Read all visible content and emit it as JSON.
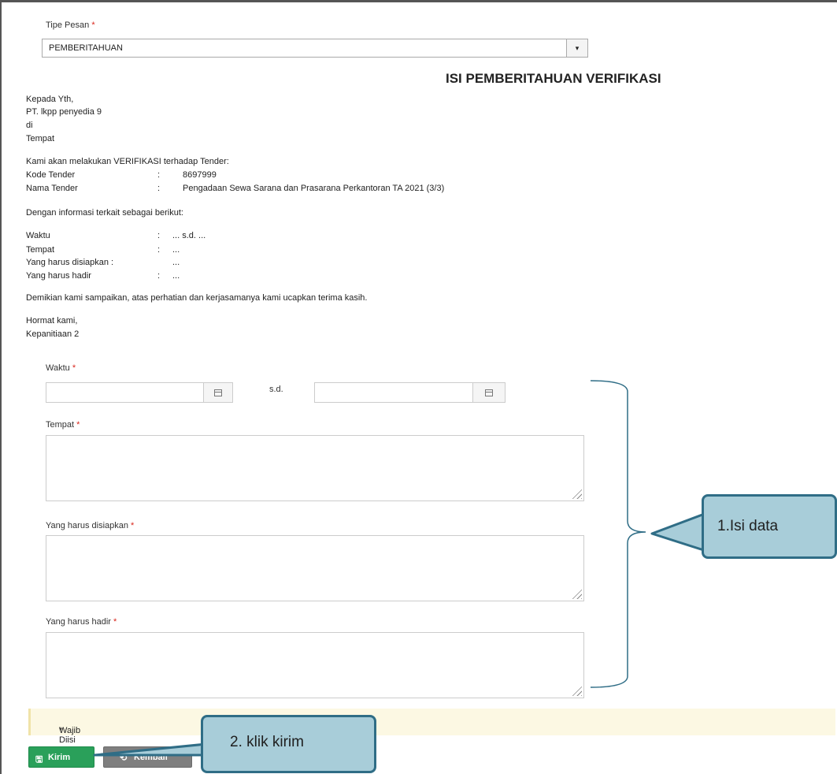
{
  "form": {
    "tipe_pesan_label": "Tipe Pesan",
    "required_mark": "*",
    "tipe_pesan_value": "PEMBERITAHUAN",
    "dropdown_arrow": "▾"
  },
  "letter": {
    "title": "ISI PEMBERITAHUAN VERIFIKASI",
    "greeting": "Kepada Yth,",
    "recipient": "PT. lkpp penyedia 9",
    "di": "di",
    "tempat": "Tempat",
    "intro": "Kami akan melakukan VERIFIKASI terhadap Tender:",
    "tender_fields": [
      {
        "label": "Kode Tender",
        "sep": ":",
        "value": "8697999"
      },
      {
        "label": "Nama Tender",
        "sep": ":",
        "value": "Pengadaan Sewa Sarana dan Prasarana Perkantoran TA 2021 (3/3)"
      }
    ],
    "info_intro": "Dengan informasi terkait sebagai berikut:",
    "info_fields": [
      {
        "label": "Waktu",
        "sep": ":",
        "value": "... s.d. ..."
      },
      {
        "label": "Tempat",
        "sep": ":",
        "value": "..."
      },
      {
        "label": "Yang harus disiapkan :",
        "sep": "",
        "value": "..."
      },
      {
        "label": "Yang harus hadir",
        "sep": ":",
        "value": "..."
      }
    ],
    "closing": "Demikian kami sampaikan, atas perhatian dan kerjasamanya kami ucapkan terima kasih.",
    "regards": "Hormat kami,",
    "signature": "Kepanitiaan 2"
  },
  "fields": {
    "waktu_label": "Waktu",
    "sd_label": "s.d.",
    "tempat_label": "Tempat",
    "disiapkan_label": "Yang harus disiapkan",
    "hadir_label": "Yang harus hadir",
    "waktu_start_value": "",
    "waktu_end_value": "",
    "tempat_value": "",
    "disiapkan_value": "",
    "hadir_value": ""
  },
  "notice": {
    "text": "Wajib Diisi"
  },
  "buttons": {
    "kirim_icon": "🖫",
    "kirim_label": "Kirim",
    "kembali_icon": "⟲",
    "kembali_label": "Kembali"
  },
  "callouts": {
    "step1": "1.Isi data",
    "step2": "2. klik kirim"
  },
  "colors": {
    "callout_fill": "#a8cdd9",
    "callout_border": "#2f6d86",
    "kirim_button": "#2aa05a",
    "kembali_button": "#7f7f7f",
    "required": "#d9261c",
    "notice_bg": "#fcf8e3"
  }
}
